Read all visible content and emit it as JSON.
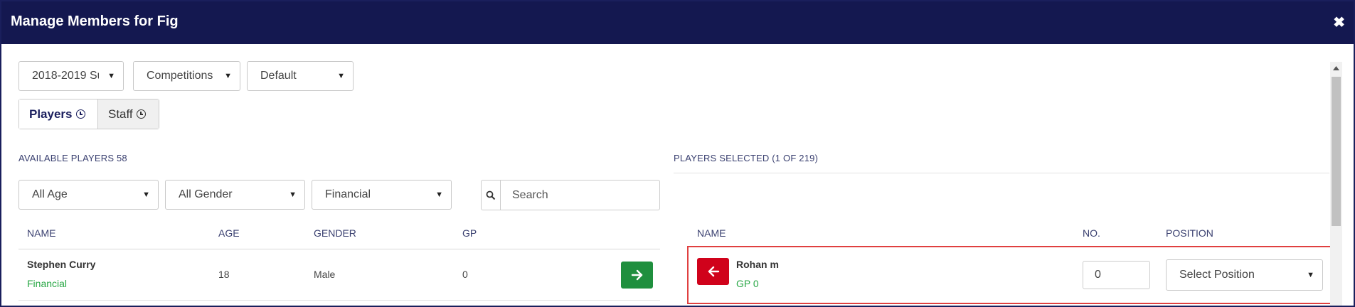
{
  "window": {
    "title": "Manage Members for Fig",
    "close_glyph": "✖"
  },
  "filters_top": {
    "season": "2018-2019 Su",
    "competition": "Competitions",
    "template": "Default"
  },
  "tabs": [
    {
      "label": "Players"
    },
    {
      "label": "Staff"
    }
  ],
  "available": {
    "heading": "AVAILABLE PLAYERS 58",
    "filters": {
      "age": "All Age",
      "gender": "All Gender",
      "status": "Financial"
    },
    "search": {
      "placeholder": "Search"
    },
    "columns": {
      "name": "NAME",
      "age": "AGE",
      "gender": "GENDER",
      "gp": "GP"
    },
    "rows": [
      {
        "name": "Stephen Curry",
        "status": "Financial",
        "age": "18",
        "gender": "Male",
        "gp": "0"
      }
    ]
  },
  "selected": {
    "heading": "PLAYERS SELECTED (1 OF 219)",
    "columns": {
      "name": "NAME",
      "no": "NO.",
      "position": "POSITION"
    },
    "rows": [
      {
        "name": "Rohan m",
        "gp": "GP 0",
        "number": "0",
        "position": "Select Position"
      }
    ]
  },
  "colors": {
    "header_bg": "#141850",
    "add_button": "#1f8f3e",
    "remove_button": "#d0021b",
    "status_green": "#28a745",
    "highlight": "#e04040"
  },
  "icons": {
    "close": "close-icon",
    "clock": "clock-icon",
    "search": "search-icon",
    "arrow_right": "arrow-right-icon",
    "arrow_left": "arrow-left-icon",
    "caret": "caret-down-icon"
  }
}
